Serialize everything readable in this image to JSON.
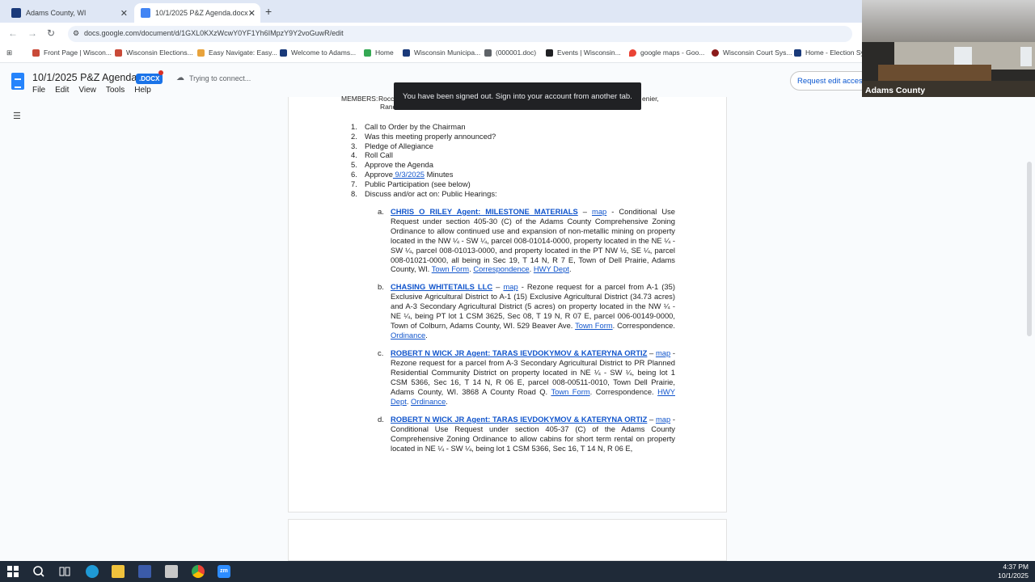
{
  "browser": {
    "tabs": [
      {
        "title": "Adams County, WI"
      },
      {
        "title": "10/1/2025 P&Z Agenda.docx -"
      }
    ],
    "url": "docs.google.com/document/d/1GXL0KXzWcwY0YF1Yh6IMpzY9Y2voGuwR/edit",
    "bookmarks": [
      "Front Page | Wiscon...",
      "Wisconsin Elections...",
      "Easy Navigate: Easy...",
      "Welcome to Adams...",
      "Home",
      "Wisconsin Municipa...",
      "(000001.doc)",
      "Events | Wisconsin...",
      "google maps - Goo...",
      "Wisconsin Court Sys...",
      "Home - Election Sy..."
    ]
  },
  "docs": {
    "title": "10/1/2025 P&Z Agenda",
    "badge": ".DOCX",
    "status": "Trying to connect...",
    "menus": [
      "File",
      "Edit",
      "View",
      "Tools",
      "Help"
    ],
    "request_edit": "Request edit access"
  },
  "toast": "You have been signed out. Sign into your account from another tab.",
  "video": {
    "label": "Adams County"
  },
  "document": {
    "members_label": "MEMBERS:",
    "members_partial_1": "Rocc",
    "members_partial_2": "Rand",
    "members_tail": "enier,",
    "agenda": [
      {
        "n": "1.",
        "text": "Call to Order by the Chairman"
      },
      {
        "n": "2.",
        "text": "Was this meeting properly announced?"
      },
      {
        "n": "3.",
        "text": "Pledge of Allegiance"
      },
      {
        "n": "4.",
        "text": "Roll Call"
      },
      {
        "n": "5.",
        "text": "Approve the Agenda"
      },
      {
        "n": "6.",
        "text_pre": "Approve",
        "link": " 9/3/2025",
        "text_post": " Minutes"
      },
      {
        "n": "7.",
        "text": "Public Participation (see below)"
      },
      {
        "n": "8.",
        "text": "Discuss and/or act on: Public Hearings:"
      }
    ],
    "hearings": [
      {
        "letter": "a.",
        "name": "CHRIS O RILEY Agent: MILESTONE MATERIALS",
        "sep": " – ",
        "map": "map",
        "body": " - Conditional Use Request under section 405-30 (C) of the Adams County Comprehensive Zoning Ordinance to allow continued use and expansion of non-metallic mining on property located in the NW ¼ - SW ¼, parcel 008-01014-0000, property located in the NE ¼ - SW ¼, parcel 008-01013-0000, and property located in the PT NW ½, SE ¼, parcel 008-01021-0000, all being in Sec 19, T 14 N, R 7 E, Town of Dell Prairie, Adams County, WI. ",
        "links": [
          "Town Form",
          "Correspondence",
          "HWY Dept"
        ]
      },
      {
        "letter": "b.",
        "name": "CHASING WHITETAILS LLC",
        "sep": " – ",
        "map": "map",
        "body": " - Rezone request for a parcel from A-1 (35) Exclusive Agricultural District to A-1 (15) Exclusive Agricultural District (34.73 acres) and A-3 Secondary Agricultural District (5 acres) on property located in the NW ¼ - NE ¼, being PT lot 1 CSM 3625, Sec 08, T 19 N, R 07 E, parcel 006-00149-0000, Town of Colburn, Adams County, WI. 529 Beaver Ave. ",
        "links": [
          "Town Form",
          "Correspondence.",
          "Ordinance"
        ]
      },
      {
        "letter": "c.",
        "name": "ROBERT N WICK JR Agent: TARAS IEVDOKYMOV & KATERYNA ORTIZ",
        "sep": " – ",
        "map": "map",
        "body": " - Rezone request for a parcel from A-3 Secondary Agricultural District to PR Planned Residential Community District on property located in NE ¼ - SW ¼, being lot 1 CSM 5366, Sec 16, T 14 N, R 06 E, parcel 008-00511-0010, Town Dell Prairie, Adams County, WI. 3868 A County Road Q. ",
        "links": [
          "Town Form",
          "Correspondence.",
          "HWY Dept",
          "Ordinance"
        ]
      },
      {
        "letter": "d.",
        "name": "ROBERT N WICK JR Agent: TARAS IEVDOKYMOV & KATERYNA ORTIZ",
        "sep": " – ",
        "map": "map",
        "body": " - Conditional Use Request under section 405-37 (C) of the Adams County Comprehensive Zoning Ordinance to allow cabins for short term rental on property located in NE ¼ - SW ¼, being lot 1 CSM 5366, Sec 16, T 14 N, R 06 E,"
      }
    ]
  },
  "taskbar": {
    "time": "4:37 PM",
    "date": "10/1/2025"
  }
}
